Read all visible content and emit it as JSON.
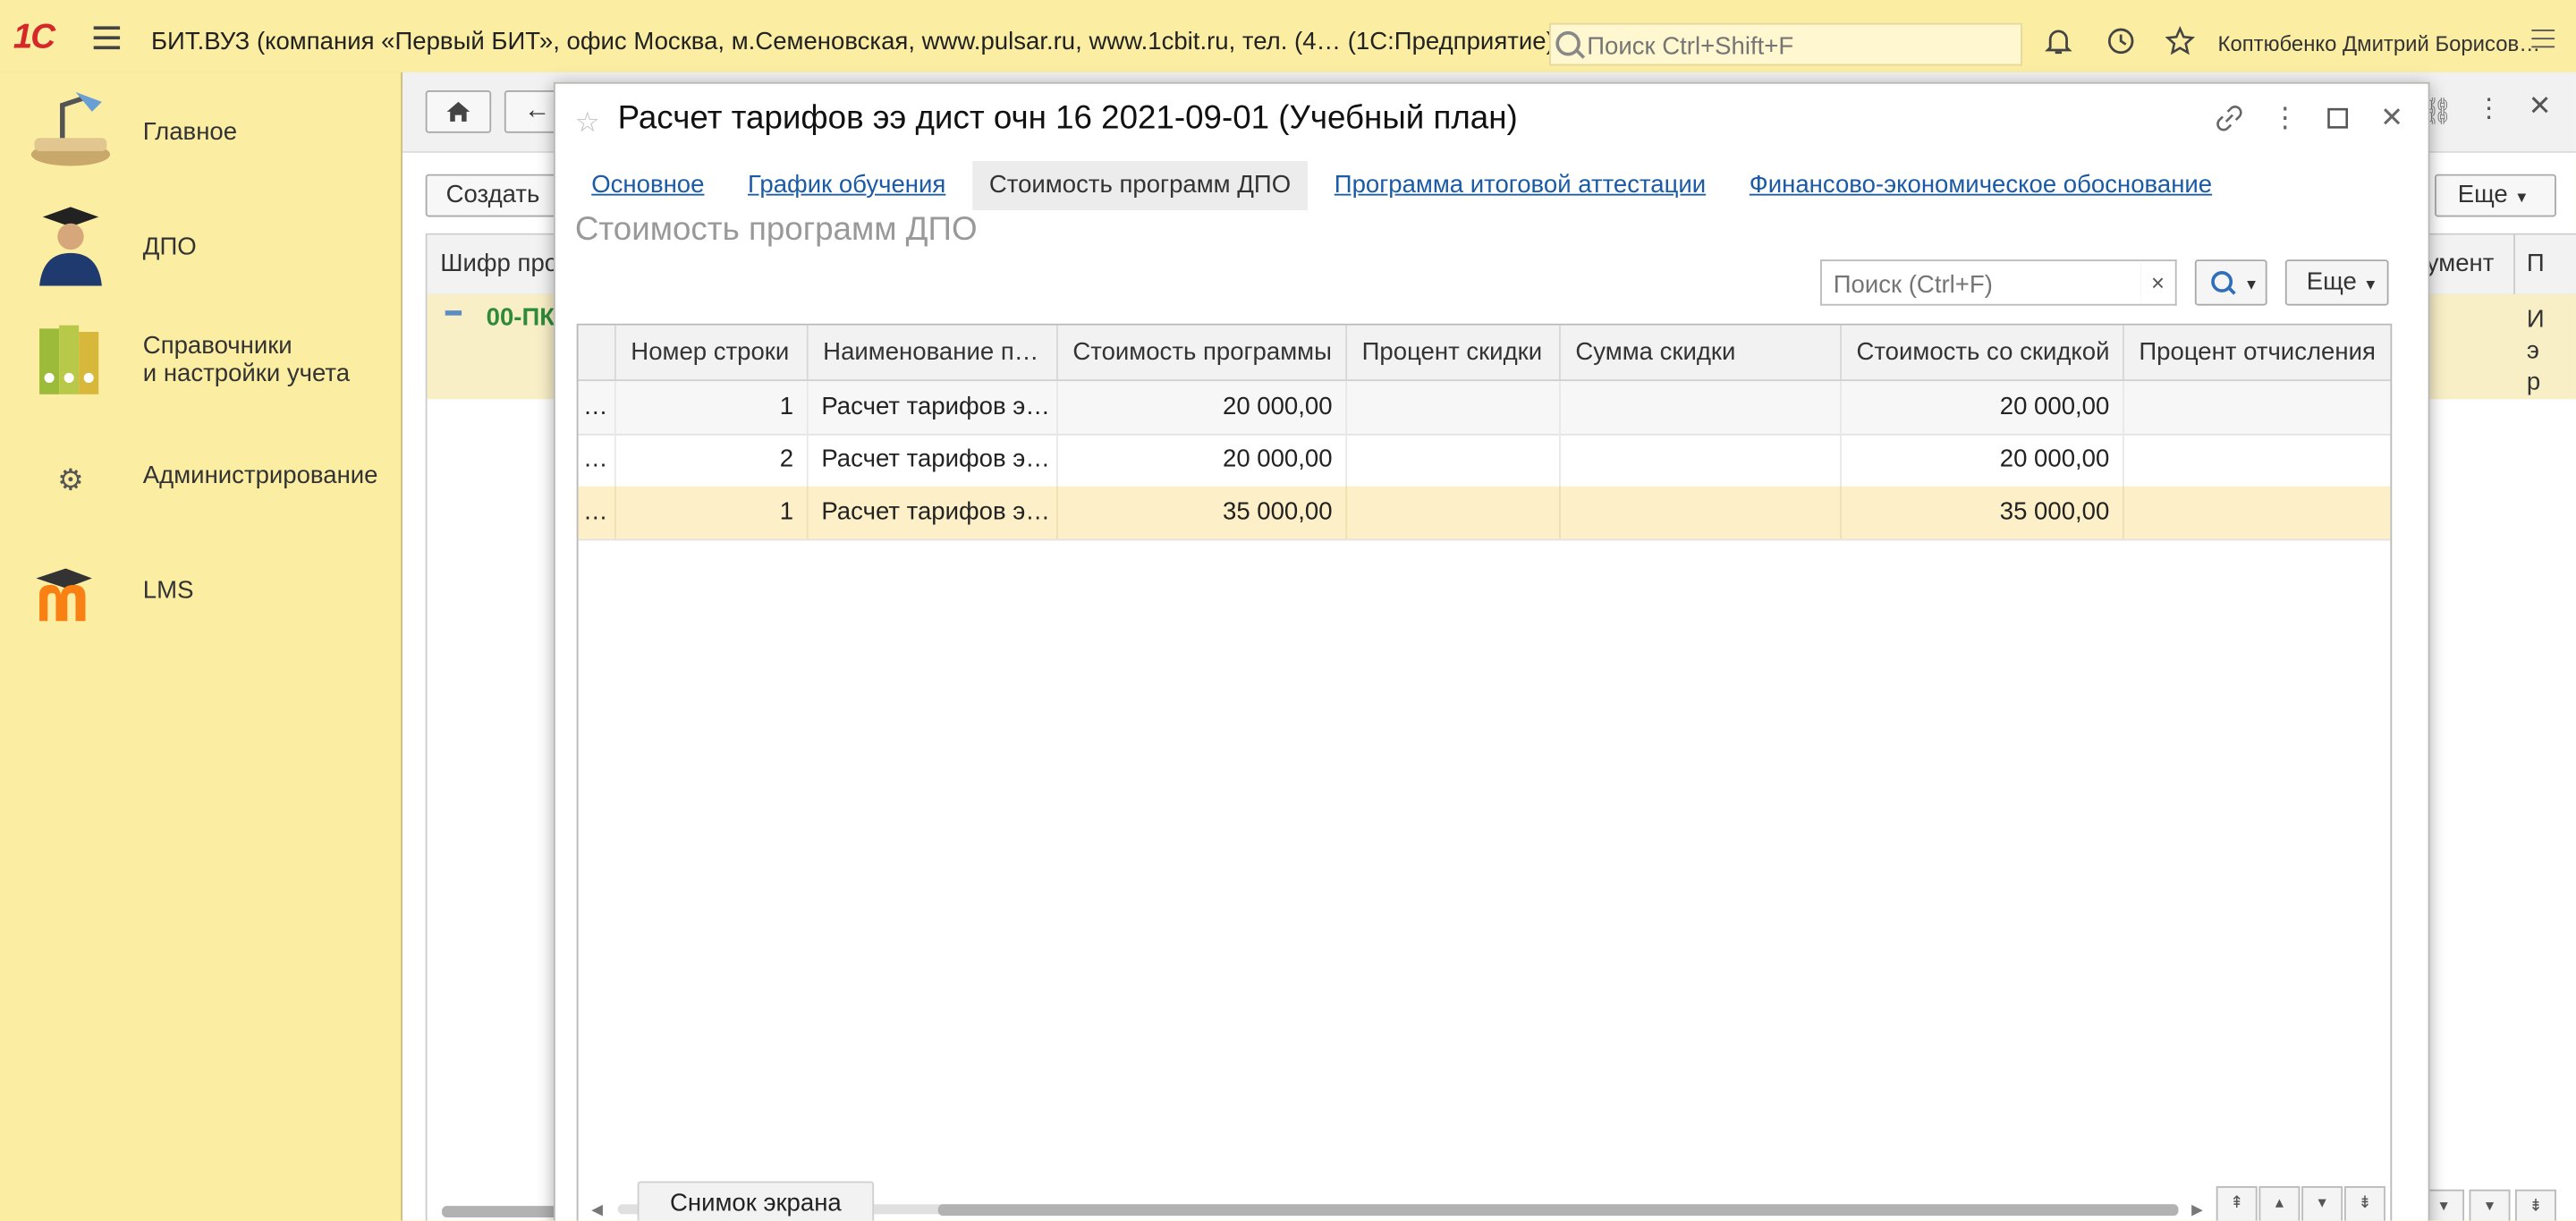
{
  "topbar": {
    "logo": "1С",
    "app_title": "БИТ.ВУЗ (компания «Первый БИТ», офис Москва, м.Семеновская, www.pulsar.ru, www.1cbit.ru, тел. (4…  (1С:Предприятие)",
    "search_placeholder": "Поиск Ctrl+Shift+F",
    "user": "Коптюбенко Дмитрий Борисов…"
  },
  "sidebar": {
    "items": [
      {
        "label": "Главное",
        "icon": "desk-lamp-icon"
      },
      {
        "label": "ДПО",
        "icon": "graduate-icon"
      },
      {
        "label": "Справочники",
        "label2": "и настройки учета",
        "icon": "binders-icon"
      },
      {
        "label": "Администрирование",
        "icon": "gear-icon"
      },
      {
        "label": "LMS",
        "icon": "moodle-icon"
      }
    ]
  },
  "background_form": {
    "create_label": "Создать",
    "more_label": "Еще",
    "col_first": "Шифр про",
    "col_doc": "умент",
    "col_last": "П",
    "row_code": "00-ПК",
    "row_text": "И э р"
  },
  "modal": {
    "title": "Расчет тарифов ээ дист очн 16 2021-09-01 (Учебный план)",
    "tabs": [
      {
        "label": "Основное",
        "active": false
      },
      {
        "label": "График обучения",
        "active": false
      },
      {
        "label": "Стоимость программ ДПО",
        "active": true
      },
      {
        "label": "Программа итоговой аттестации",
        "active": false
      },
      {
        "label": "Финансово-экономическое обоснование",
        "active": false
      }
    ],
    "section_title": "Стоимость программ ДПО",
    "search_placeholder": "Поиск (Ctrl+F)",
    "clear_label": "×",
    "more_label": "Еще",
    "columns": [
      "Номер строки",
      "Наименование п…",
      "Стоимость программы",
      "Процент скидки",
      "Сумма скидки",
      "Стоимость со скидкой",
      "Процент отчисления"
    ],
    "rows": [
      {
        "lead": "…",
        "num": "1",
        "name": "Расчет тарифов э…",
        "cost": "20 000,00",
        "discount_pct": "",
        "discount_sum": "",
        "cost_discounted": "20 000,00",
        "deduction_pct": ""
      },
      {
        "lead": "…",
        "num": "2",
        "name": "Расчет тарифов э…",
        "cost": "20 000,00",
        "discount_pct": "",
        "discount_sum": "",
        "cost_discounted": "20 000,00",
        "deduction_pct": ""
      },
      {
        "lead": "…",
        "num": "1",
        "name": "Расчет тарифов э…",
        "cost": "35 000,00",
        "discount_pct": "",
        "discount_sum": "",
        "cost_discounted": "35 000,00",
        "deduction_pct": ""
      }
    ],
    "selected_row": 2
  },
  "snapshot_label": "Снимок экрана",
  "colors": {
    "panel_bg": "#fbeda2",
    "link": "#1b5ba6",
    "selected_row": "#fdf0c8",
    "logo": "#d6272b"
  }
}
